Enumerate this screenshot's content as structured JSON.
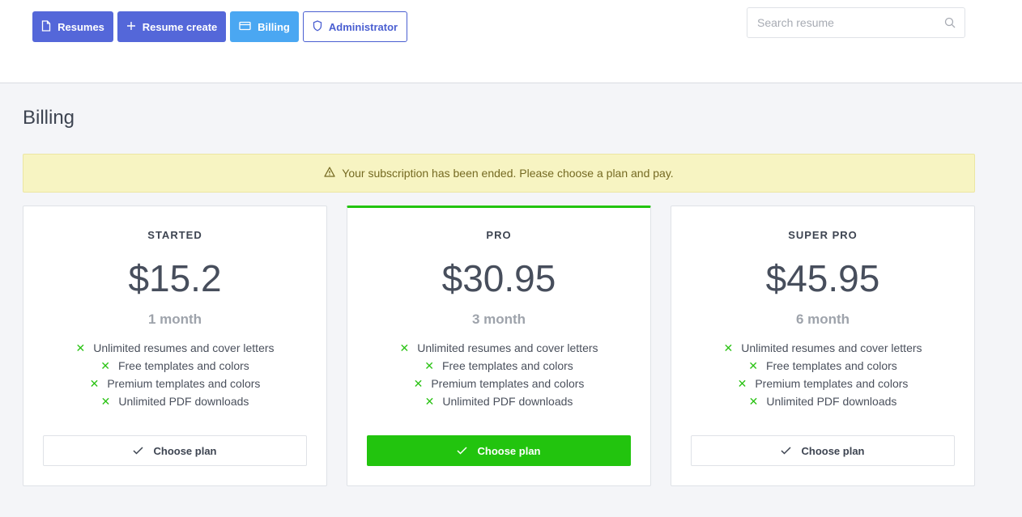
{
  "nav": {
    "resumes": "Resumes",
    "resume_create": "Resume create",
    "billing": "Billing",
    "administrator": "Administrator"
  },
  "search": {
    "placeholder": "Search resume",
    "icon": "search-icon"
  },
  "page": {
    "title": "Billing"
  },
  "alert": {
    "icon": "warning-icon",
    "text": "Your subscription has been ended. Please choose a plan and pay."
  },
  "plans": [
    {
      "name": "STARTED",
      "price": "$15.2",
      "period": "1 month",
      "features": [
        "Unlimited resumes and cover letters",
        "Free templates and colors",
        "Premium templates and colors",
        "Unlimited PDF downloads"
      ],
      "button": "Choose plan"
    },
    {
      "name": "PRO",
      "price": "$30.95",
      "period": "3 month",
      "features": [
        "Unlimited resumes and cover letters",
        "Free templates and colors",
        "Premium templates and colors",
        "Unlimited PDF downloads"
      ],
      "button": "Choose plan"
    },
    {
      "name": "SUPER PRO",
      "price": "$45.95",
      "period": "6 month",
      "features": [
        "Unlimited resumes and cover letters",
        "Free templates and colors",
        "Premium templates and colors",
        "Unlimited PDF downloads"
      ],
      "button": "Choose plan"
    }
  ],
  "colors": {
    "primary": "#5467d9",
    "info": "#4aa7f2",
    "success": "#22c40e",
    "alert_bg": "#f7f4c2"
  }
}
